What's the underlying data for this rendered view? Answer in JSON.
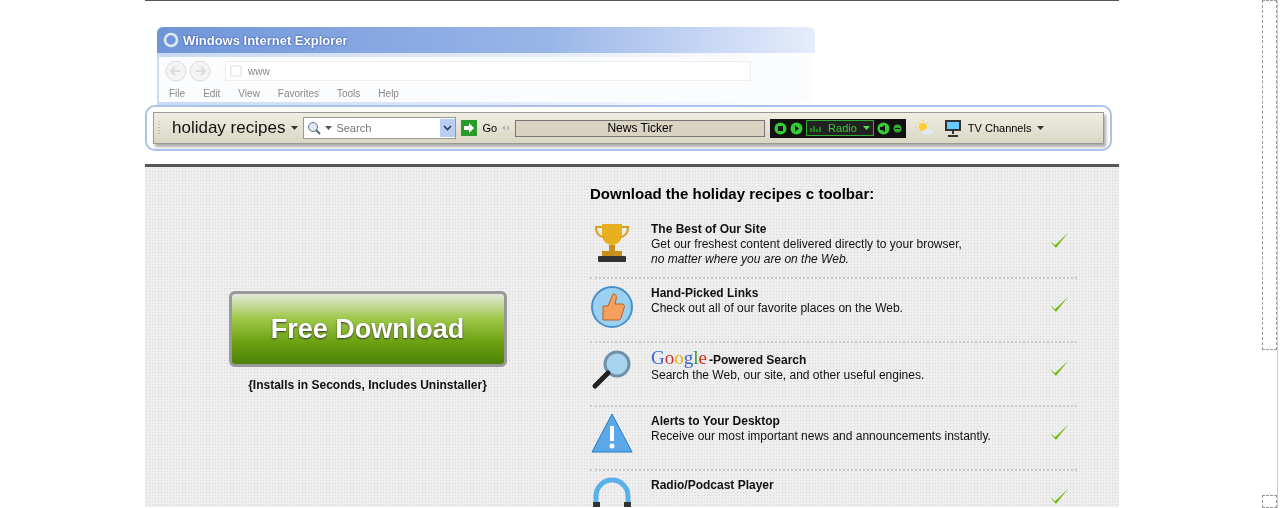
{
  "browser_preview": {
    "title": "Windows Internet Explorer",
    "address": "www",
    "menu": [
      "File",
      "Edit",
      "View",
      "Favorites",
      "Tools",
      "Help"
    ]
  },
  "toolbar": {
    "brand": "holiday recipes",
    "search": {
      "placeholder": "Search"
    },
    "go": "Go",
    "ticker": "News Ticker",
    "radio": "Radio",
    "tv": "TV Channels"
  },
  "download": {
    "button": "Free Download",
    "caption": "{Installs in Seconds, Includes Uninstaller}"
  },
  "features": {
    "heading": "Download the holiday recipes c toolbar:",
    "items": [
      {
        "title": "The Best of Our Site",
        "text": "Get our freshest content delivered directly to your browser,",
        "note": "no matter where you are on the Web.",
        "checked": true
      },
      {
        "title": "Hand-Picked Links",
        "text": "Check out all of our favorite places on the Web.",
        "checked": true
      },
      {
        "logo": "Google",
        "title": "-Powered Search",
        "text": "Search the Web, our site, and other useful engines.",
        "checked": true
      },
      {
        "title": "Alerts to Your Desktop",
        "text": "Receive our most important news and announcements instantly.",
        "checked": true
      },
      {
        "title": "Radio/Podcast Player",
        "checked": true
      }
    ]
  }
}
